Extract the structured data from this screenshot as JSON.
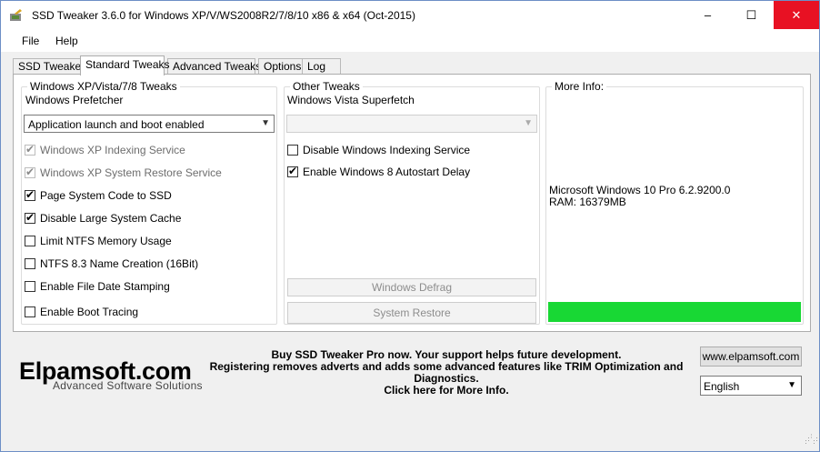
{
  "window": {
    "title": "SSD Tweaker 3.6.0 for Windows XP/V/WS2008R2/7/8/10 x86 & x64 (Oct-2015)",
    "controls": {
      "minimize": "–",
      "maximize": "☐",
      "close": "✕"
    }
  },
  "menu": {
    "file": "File",
    "help": "Help"
  },
  "tabs": [
    {
      "label": "SSD Tweaker"
    },
    {
      "label": "Standard Tweaks"
    },
    {
      "label": "Advanced Tweaks"
    },
    {
      "label": "Options"
    },
    {
      "label": "Log"
    }
  ],
  "left_group": {
    "legend": "Windows XP/Vista/7/8 Tweaks",
    "prefetcher_label": "Windows Prefetcher",
    "prefetcher_value": "Application launch and boot enabled",
    "checkboxes": [
      {
        "label": "Windows XP Indexing Service"
      },
      {
        "label": "Windows XP System Restore Service"
      },
      {
        "label": "Page System Code to SSD"
      },
      {
        "label": "Disable Large System Cache"
      },
      {
        "label": "Limit NTFS Memory Usage"
      },
      {
        "label": "NTFS 8.3 Name Creation (16Bit)"
      },
      {
        "label": "Enable File Date Stamping"
      },
      {
        "label": "Enable Boot Tracing"
      }
    ]
  },
  "middle_group": {
    "legend": "Other Tweaks",
    "superfetch_label": "Windows Vista Superfetch",
    "superfetch_value": "",
    "checkboxes": [
      {
        "label": "Disable Windows Indexing Service"
      },
      {
        "label": "Enable Windows 8 Autostart Delay"
      }
    ],
    "defrag_button": "Windows Defrag",
    "restore_button": "System Restore"
  },
  "right_group": {
    "legend": "More Info:",
    "os": "Microsoft Windows 10 Pro 6.2.9200.0",
    "ram": "RAM: 16379MB",
    "status_color": "#18d834"
  },
  "footer": {
    "brand": "Elpamsoft.com",
    "brand_sub": "Advanced Software Solutions",
    "promo_line1": "Buy SSD Tweaker Pro now. Your support helps future development.",
    "promo_line2": "Registering removes adverts and adds some advanced features like TRIM Optimization and",
    "promo_line3": "Diagnostics.",
    "promo_line4": "Click here for More Info.",
    "website_button": "www.elpamsoft.com",
    "language": "English"
  },
  "checks": {
    "mark": "✔"
  }
}
